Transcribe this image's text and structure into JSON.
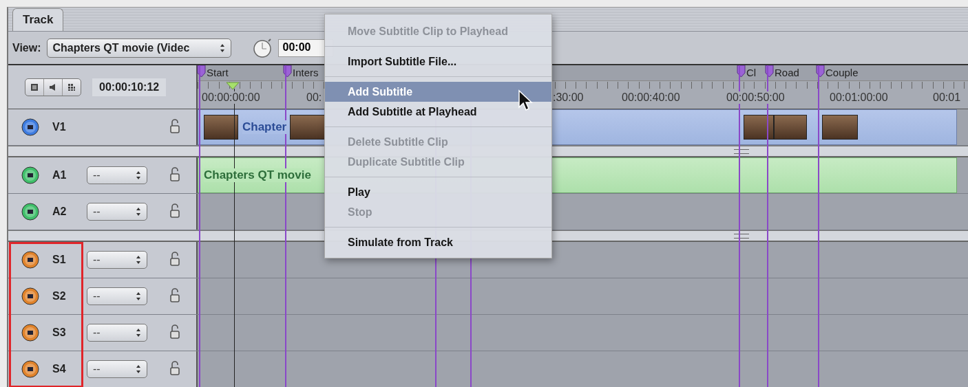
{
  "tab": {
    "label": "Track",
    "selected": true
  },
  "toolbar": {
    "view_label": "View:",
    "view_popup": "Chapters QT movie (Videc",
    "timecode": "00:00"
  },
  "header": {
    "timecode": "00:00:10:12"
  },
  "ruler": {
    "markers": [
      "Start",
      "Inters",
      "Cl",
      "Road",
      "Couple"
    ],
    "labels": [
      "00:00:00:00",
      "00:",
      ":30:00",
      "00:00:40:00",
      "00:00:50:00",
      "00:01:00:00",
      "00:01"
    ]
  },
  "groups": [
    {
      "highlighted": false,
      "tracks": [
        {
          "name": "V1",
          "kind": "video",
          "clip": {
            "label": "Chapter"
          }
        }
      ]
    },
    {
      "highlighted": false,
      "tracks": [
        {
          "name": "A1",
          "kind": "audio",
          "popup": "--",
          "clip": {
            "label": "Chapters QT movie"
          }
        },
        {
          "name": "A2",
          "kind": "audio",
          "popup": "--"
        }
      ]
    },
    {
      "highlighted": true,
      "tracks": [
        {
          "name": "S1",
          "kind": "subtitle",
          "popup": "--"
        },
        {
          "name": "S2",
          "kind": "subtitle",
          "popup": "--"
        },
        {
          "name": "S3",
          "kind": "subtitle",
          "popup": "--"
        },
        {
          "name": "S4",
          "kind": "subtitle",
          "popup": "--"
        }
      ]
    }
  ],
  "menu": {
    "sections": [
      [
        {
          "label": "Move Subtitle Clip to Playhead",
          "disabled": true,
          "selected": false
        }
      ],
      [
        {
          "label": "Import Subtitle File...",
          "disabled": false,
          "selected": false
        }
      ],
      [
        {
          "label": "Add Subtitle",
          "disabled": false,
          "selected": true
        },
        {
          "label": "Add Subtitle at Playhead",
          "disabled": false,
          "selected": false
        }
      ],
      [
        {
          "label": "Delete Subtitle Clip",
          "disabled": true,
          "selected": false
        },
        {
          "label": "Duplicate Subtitle Clip",
          "disabled": true,
          "selected": false
        }
      ],
      [
        {
          "label": "Play",
          "disabled": false,
          "selected": false
        },
        {
          "label": "Stop",
          "disabled": true,
          "selected": false
        }
      ],
      [
        {
          "label": "Simulate from Track",
          "disabled": false,
          "selected": false
        }
      ]
    ]
  }
}
